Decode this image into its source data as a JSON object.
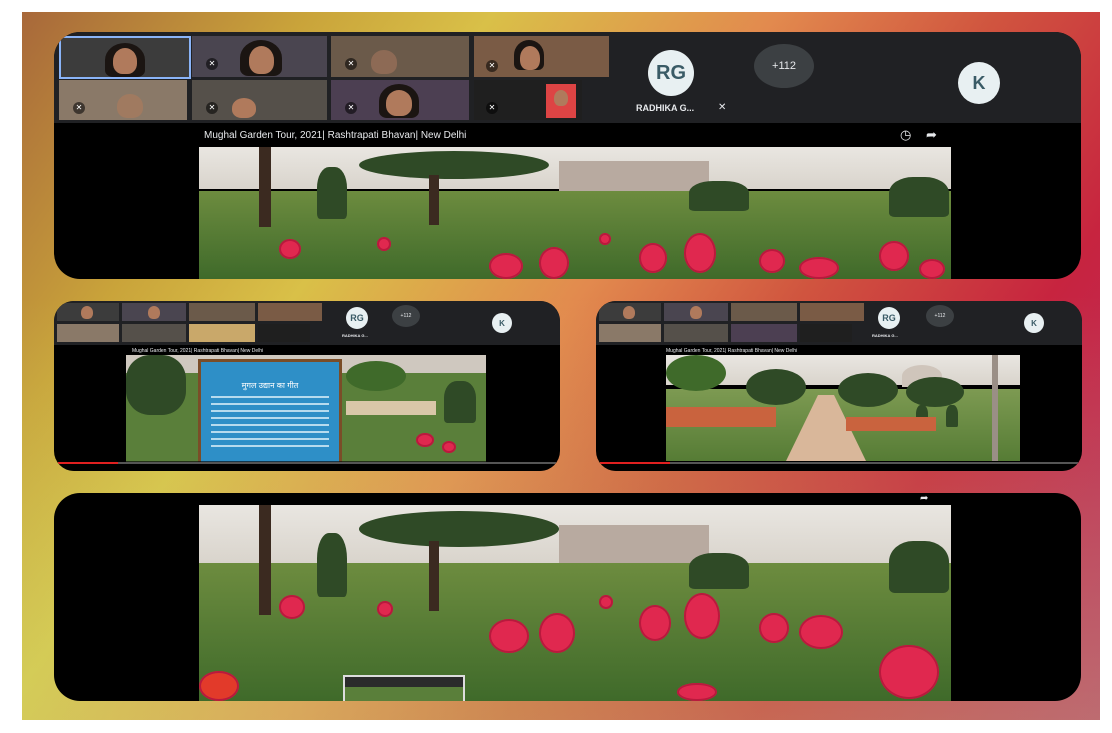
{
  "meeting": {
    "presenter_initials": "RG",
    "presenter_name": "RADHIKA G...",
    "presenter_name_small": "RADHIKA G...",
    "others_count": "+112",
    "guest_initials": "K"
  },
  "video": {
    "title": "Mughal Garden Tour, 2021| Rashtrapati Bhavan| New Delhi",
    "title_small": "Mughal Garden Tour, 2021| Rashtrapati Bhavan| New Delhi"
  },
  "signboard": {
    "heading": "मुगल उद्यान का गीत"
  },
  "icons": {
    "share": "share-icon",
    "clock": "clock-icon",
    "mic_off": "mic-off-icon"
  },
  "colors": {
    "meet_dark": "#202124",
    "avatar_bg": "#e8f0f2",
    "flower": "#e0284f",
    "progress": "#e02020"
  }
}
